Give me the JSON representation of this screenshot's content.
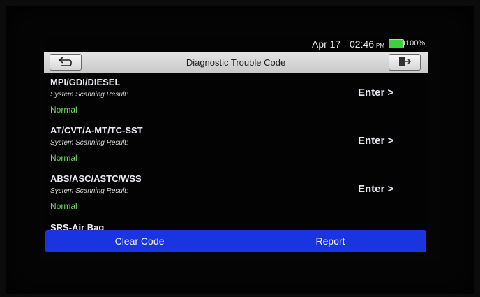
{
  "status": {
    "date": "Apr 17",
    "time": "02:46",
    "ampm": "PM",
    "battery": "100%",
    "battery_level": 100
  },
  "header": {
    "title": "Diagnostic Trouble Code",
    "back_icon": "back-arrow-icon",
    "exit_icon": "exit-door-icon"
  },
  "systems": [
    {
      "name": "MPI/GDI/DIESEL",
      "sub_label": "System Scanning Result:",
      "result": "Normal",
      "action": "Enter >"
    },
    {
      "name": "AT/CVT/A-MT/TC-SST",
      "sub_label": "System Scanning Result:",
      "result": "Normal",
      "action": "Enter >"
    },
    {
      "name": "ABS/ASC/ASTC/WSS",
      "sub_label": "System Scanning Result:",
      "result": "Normal",
      "action": "Enter >"
    },
    {
      "name": "SRS-Air Bag"
    }
  ],
  "footer": {
    "clear_label": "Clear Code",
    "report_label": "Report"
  },
  "colors": {
    "accent": "#1a35e0",
    "normal": "#6bdc5a",
    "titlebar": "#d6d6d6"
  }
}
